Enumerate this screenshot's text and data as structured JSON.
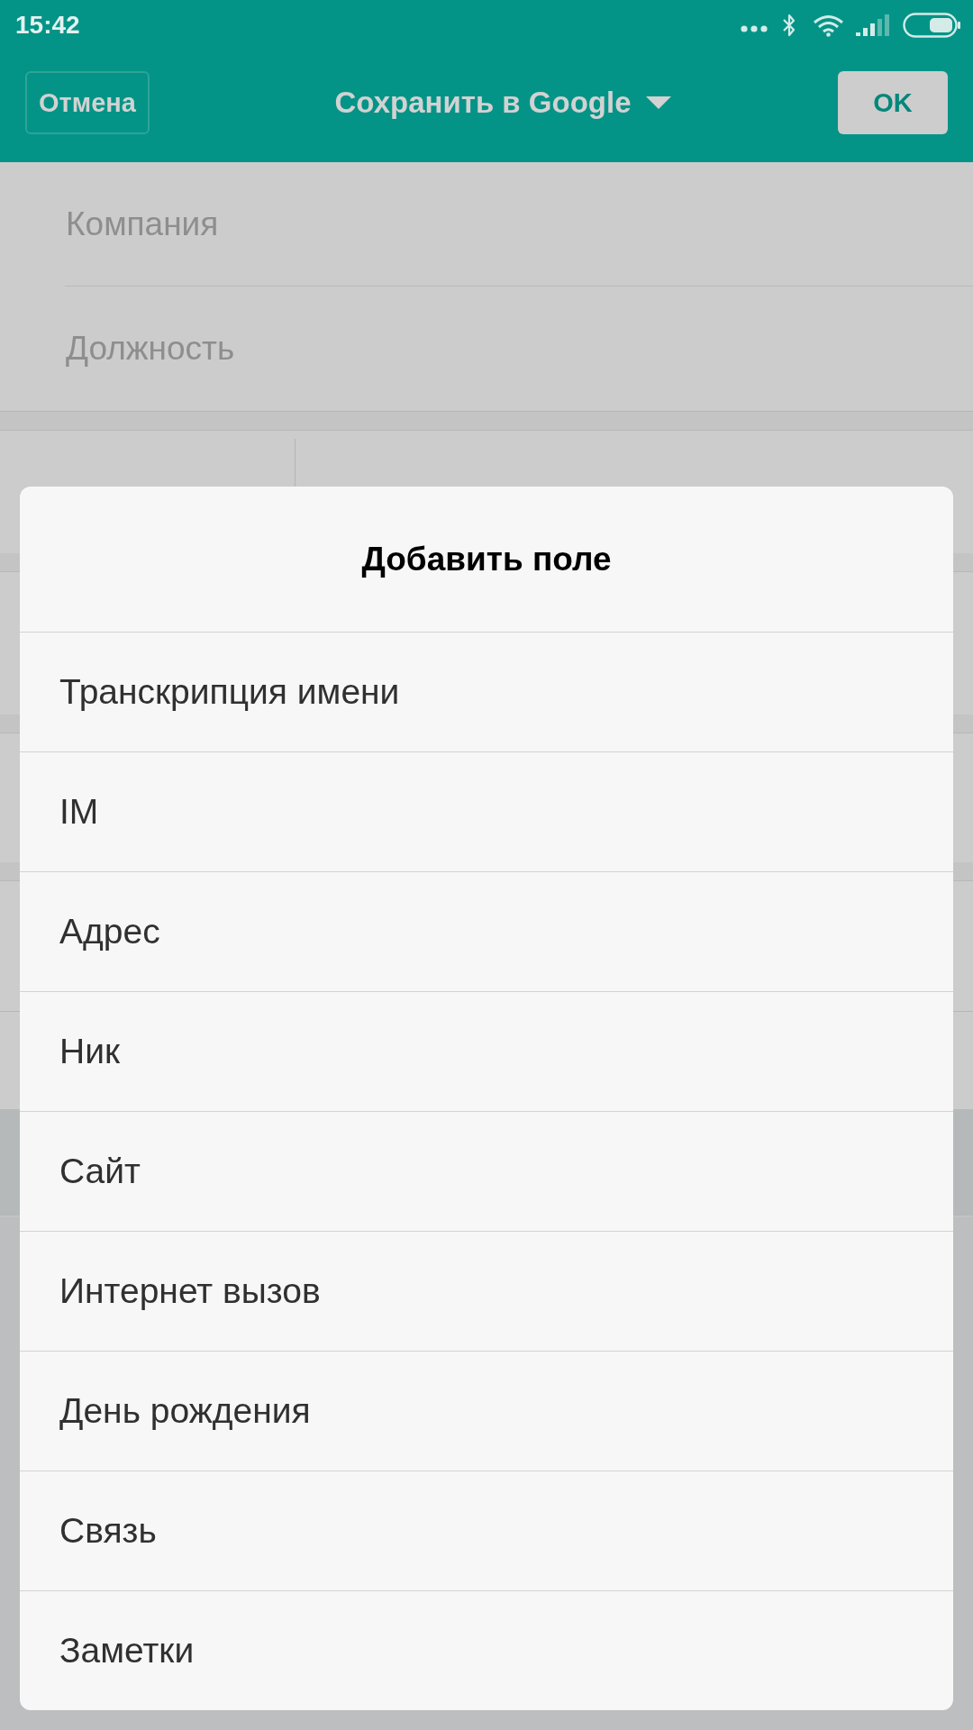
{
  "status_bar": {
    "time": "15:42"
  },
  "header": {
    "cancel_button": "Отмена",
    "title": "Сохранить в Google",
    "ok_button": "OK"
  },
  "form": {
    "fields": [
      {
        "placeholder": "Компания"
      },
      {
        "placeholder": "Должность"
      }
    ]
  },
  "dialog": {
    "title": "Добавить поле",
    "items": [
      "Транскрипция имени",
      "IM",
      "Адрес",
      "Ник",
      "Сайт",
      "Интернет вызов",
      "День рождения",
      "Связь",
      "Заметки"
    ]
  }
}
